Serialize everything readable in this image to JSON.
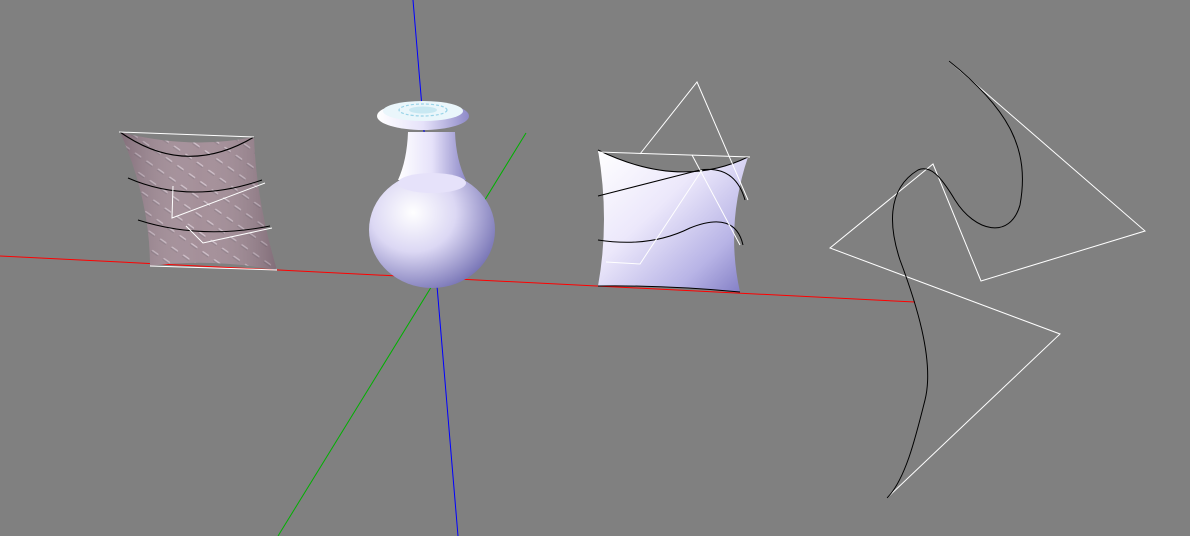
{
  "viewport": {
    "background": "#808080"
  },
  "axes": {
    "x_color": "#ff0000",
    "y_color": "#00c000",
    "z_color": "#0000ff"
  },
  "objects": [
    {
      "name": "textured-patch-surface",
      "material": "diamond-plate-metal"
    },
    {
      "name": "vase-surface",
      "material": "smooth-shaded"
    },
    {
      "name": "smooth-patch-surface",
      "material": "smooth-shaded"
    },
    {
      "name": "curve-control-polygon",
      "material": "wireframe"
    }
  ],
  "colors": {
    "control_polygon": "#ffffff",
    "curve": "#000000",
    "surface_light": "#f4f0ff",
    "surface_shadow": "#8a86c8"
  }
}
